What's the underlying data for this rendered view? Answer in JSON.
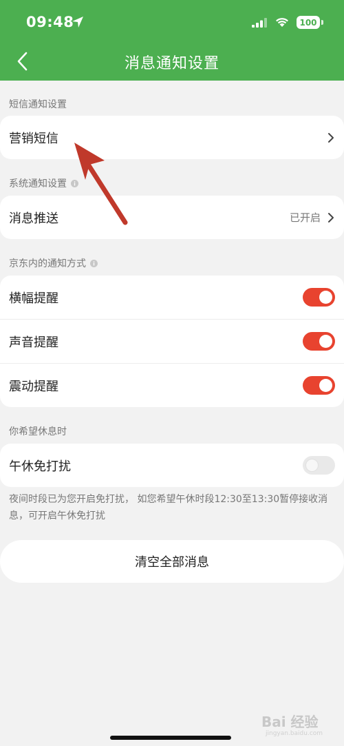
{
  "status_bar": {
    "time": "09:48",
    "battery": "100"
  },
  "header": {
    "title": "消息通知设置"
  },
  "sections": {
    "sms": {
      "label": "短信通知设置",
      "rows": [
        {
          "label": "营销短信"
        }
      ]
    },
    "system": {
      "label": "系统通知设置",
      "rows": [
        {
          "label": "消息推送",
          "value": "已开启"
        }
      ]
    },
    "in_app": {
      "label": "京东内的通知方式",
      "rows": [
        {
          "label": "横幅提醒",
          "enabled": true
        },
        {
          "label": "声音提醒",
          "enabled": true
        },
        {
          "label": "震动提醒",
          "enabled": true
        }
      ]
    },
    "rest": {
      "label": "你希望休息时",
      "rows": [
        {
          "label": "午休免打扰",
          "enabled": false
        }
      ]
    }
  },
  "note": "夜间时段已为您开启免打扰， 如您希望午休时段12:30至13:30暂停接收消息，可开启午休免打扰",
  "clear_button": "清空全部消息",
  "colors": {
    "header_bg": "#4caf50",
    "toggle_on": "#e8432f",
    "arrow": "#c0392b"
  },
  "watermark": {
    "brand": "Bai 经验",
    "url": "jingyan.baidu.com"
  }
}
